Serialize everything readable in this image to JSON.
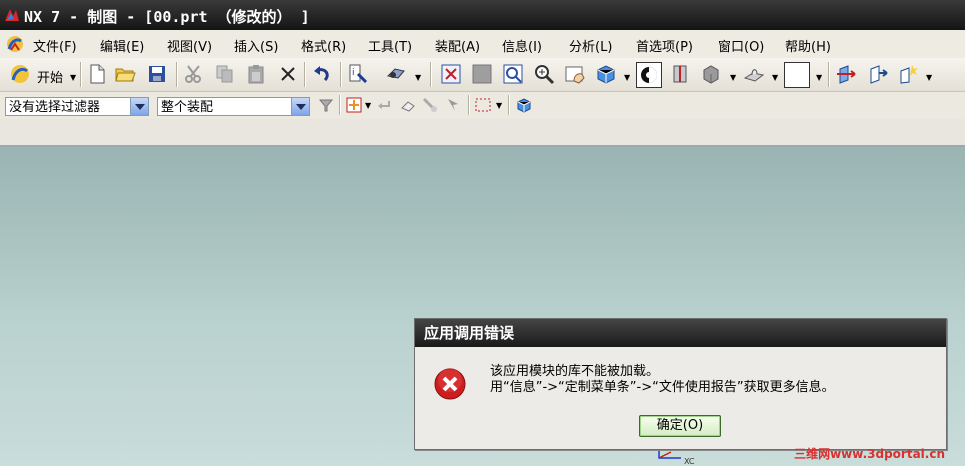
{
  "window": {
    "title": "NX 7 - 制图 - [00.prt （修改的） ]"
  },
  "menubar": {
    "items": [
      {
        "label": "文件(F)"
      },
      {
        "label": "编辑(E)"
      },
      {
        "label": "视图(V)"
      },
      {
        "label": "插入(S)"
      },
      {
        "label": "格式(R)"
      },
      {
        "label": "工具(T)"
      },
      {
        "label": "装配(A)"
      },
      {
        "label": "信息(I)"
      },
      {
        "label": "分析(L)"
      },
      {
        "label": "首选项(P)"
      },
      {
        "label": "窗口(O)"
      },
      {
        "label": "帮助(H)"
      }
    ]
  },
  "toolbar": {
    "start_label": "开始"
  },
  "selection_bar": {
    "filter_value": "没有选择过滤器",
    "scope_value": "整个装配"
  },
  "dialog": {
    "title": "应用调用错误",
    "message_line1": "该应用模块的库不能被加载。",
    "message_line2": "用“信息”->“定制菜单条”->“文件使用报告”获取更多信息。",
    "ok_label": "确定(O)"
  },
  "watermark": "三维网www.3dportal.cn",
  "axis_label": "XC",
  "colors": {
    "titlebar": "#1a1a1a",
    "viewport": "#b9d1cf",
    "error_red": "#cc1e1e",
    "watermark": "#d93030"
  }
}
